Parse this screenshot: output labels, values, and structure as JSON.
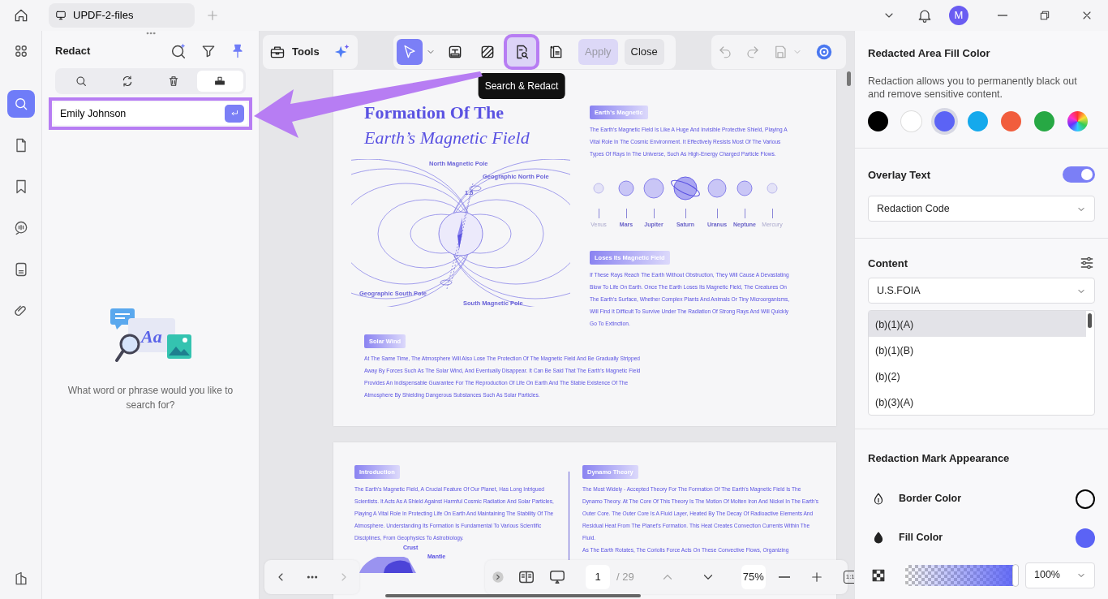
{
  "title_bar": {
    "tab_title": "UPDF-2-files",
    "avatar_initial": "M"
  },
  "sidebar": {
    "items": [
      {
        "kind": "thumbnails",
        "selected": false
      },
      {
        "kind": "search",
        "selected": true
      },
      {
        "kind": "pages",
        "selected": false
      },
      {
        "kind": "bookmarks",
        "selected": false
      },
      {
        "kind": "comments",
        "selected": false
      },
      {
        "kind": "forms",
        "selected": false
      },
      {
        "kind": "attachments",
        "selected": false
      },
      {
        "kind": "layers",
        "selected": false
      }
    ]
  },
  "left_panel": {
    "title": "Redact",
    "tabs": [
      {
        "kind": "search",
        "selected": false
      },
      {
        "kind": "replace",
        "selected": false
      },
      {
        "kind": "delete",
        "selected": false
      },
      {
        "kind": "redact",
        "selected": true
      }
    ],
    "search": {
      "value": "Emily Johnson",
      "highlighted": true
    },
    "empty_state": {
      "illustration_text": "Aa",
      "message": "What word or phrase would you like to search for?"
    }
  },
  "toolbar": {
    "tools_label": "Tools",
    "tools": [
      {
        "kind": "select",
        "selected": true,
        "highlighted": false
      },
      {
        "kind": "mark_text",
        "selected": false,
        "highlighted": false
      },
      {
        "kind": "mark_area",
        "selected": false,
        "highlighted": false
      },
      {
        "kind": "search_redact",
        "selected": false,
        "highlighted": true
      },
      {
        "kind": "redact_pages",
        "selected": false,
        "highlighted": false
      }
    ],
    "apply": {
      "label": "Apply",
      "disabled": true
    },
    "close": {
      "label": "Close"
    },
    "tooltip": "Search & Redact"
  },
  "document": {
    "page1": {
      "title_line1": "Formation Of The",
      "title_line2": "Earth’s Magnetic Field",
      "diagram_labels": [
        "North Magnetic Pole",
        "Geographic North Pole",
        "1.5",
        "Geographic South Pole",
        "South Magnetic Pole"
      ],
      "sections": [
        {
          "heading": "Earth's Magnetic",
          "text": "The Earth's Magnetic Field Is Like A Huge And Invisible Protective Shield, Playing A Vital Role In The Cosmic Environment. It Effectively Resists Most Of The Various Types Of Rays In The Universe, Such As High-Energy Charged Particle Flows."
        },
        {
          "heading": "Loses Its Magnetic Field",
          "text": "If These Rays Reach The Earth Without Obstruction, They Will Cause A Devastating Blow To Life On Earth. Once The Earth Loses Its Magnetic Field, The Creatures On The Earth's Surface, Whether Complex Plants And Animals Or Tiny Microorganisms, Will Find It Difficult To Survive Under The Radiation Of Strong Rays And Will Quickly Go To Extinction."
        }
      ],
      "planets": [
        "Venus",
        "Mars",
        "Jupiter",
        "Saturn",
        "Uranus",
        "Neptune",
        "Mercury"
      ],
      "solar_wind": {
        "heading": "Solar Wind",
        "text": "At The Same Time, The Atmosphere Will Also Lose The Protection Of The Magnetic Field And Be Gradually Stripped Away By Forces Such As The Solar Wind, And Eventually Disappear. It Can Be Said That The Earth's Magnetic Field Provides An Indispensable Guarantee For The Reproduction Of Life On Earth And The Stable Existence Of The Atmosphere By Shielding Dangerous Substances Such As Solar Particles."
      }
    },
    "page2": {
      "introduction": {
        "heading": "Introduction",
        "text": "The Earth's Magnetic Field, A Crucial Feature Of Our Planet, Has Long Intrigued Scientists. It Acts As A Shield Against Harmful Cosmic Radiation And Solar Particles, Playing A Vital Role In Protecting Life On Earth And Maintaining The Stability Of The Atmosphere. Understanding Its Formation Is Fundamental To Various Scientific Disciplines, From Geophysics To Astrobiology."
      },
      "dynamo": {
        "heading": "Dynamo Theory",
        "paragraphs": [
          "The Most Widely - Accepted Theory For The Formation Of The Earth's Magnetic Field Is The Dynamo Theory. At The Core Of This Theory Is The Motion Of Molten Iron And Nickel In The Earth's Outer Core. The Outer Core Is A Fluid Layer, Heated By The Decay Of Radioactive Elements And Residual Heat From The Planet's Formation. This Heat Creates Convection Currents Within The Fluid.",
          "As The Earth Rotates, The Coriolis Force Acts On These Convective Flows, Organizing"
        ]
      },
      "figure_labels": [
        "Crust",
        "Mantle"
      ]
    }
  },
  "page_nav": {
    "page": "1",
    "total": "/ 29",
    "zoom": "75%",
    "actual_size": "1:1"
  },
  "right_panel": {
    "fill_color": {
      "title": "Redacted Area Fill Color",
      "description": "Redaction allows you to permanently black out and remove sensitive content.",
      "swatches": [
        {
          "kind": "color",
          "color": "#000000",
          "selected": false
        },
        {
          "kind": "color",
          "color": "#ffffff",
          "selected": false
        },
        {
          "kind": "color",
          "color": "#5b63f5",
          "selected": true
        },
        {
          "kind": "color",
          "color": "#15a9ec",
          "selected": false
        },
        {
          "kind": "color",
          "color": "#f15d3d",
          "selected": false
        },
        {
          "kind": "color",
          "color": "#27a844",
          "selected": false
        },
        {
          "kind": "picker",
          "selected": false
        }
      ]
    },
    "overlay_text": {
      "label": "Overlay Text",
      "on": true,
      "select": "Redaction Code"
    },
    "content": {
      "label": "Content",
      "select": "U.S.FOIA",
      "codes": [
        {
          "label": "(b)(1)(A)",
          "selected": true
        },
        {
          "label": "(b)(1)(B)",
          "selected": false
        },
        {
          "label": "(b)(2)",
          "selected": false
        },
        {
          "label": "(b)(3)(A)",
          "selected": false
        }
      ]
    },
    "appearance": {
      "title": "Redaction Mark Appearance",
      "rows": [
        {
          "kind": "border",
          "label": "Border Color",
          "color": "#000000"
        },
        {
          "kind": "fill",
          "label": "Fill Color",
          "color": "#5b63f5"
        }
      ],
      "opacity": {
        "level": 1,
        "reading": "100%"
      }
    }
  }
}
